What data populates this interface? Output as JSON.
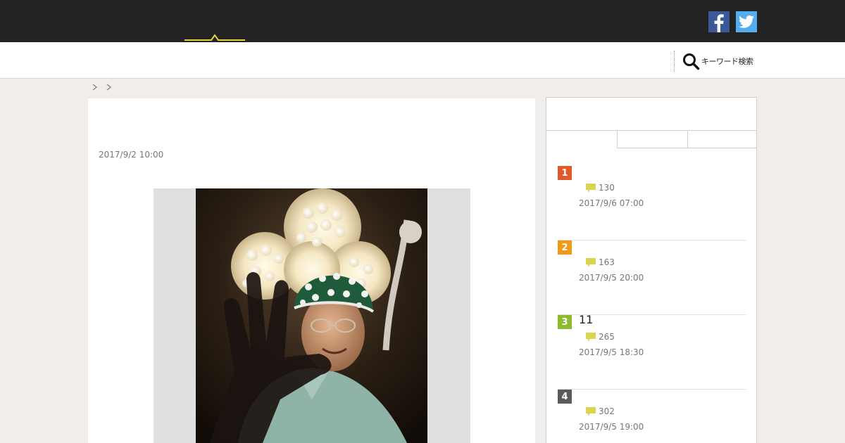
{
  "header": {
    "colors": {
      "bar": "#232323",
      "logo_accent": "#e5d23a",
      "facebook": "#3b5998",
      "twitter": "#55acee"
    },
    "social": [
      {
        "icon": "facebook-icon"
      },
      {
        "icon": "twitter-icon"
      }
    ]
  },
  "search": {
    "label": "キーワード検索",
    "icon": "search-icon"
  },
  "breadcrumb": {
    "separator_icon": "chevron-right-icon"
  },
  "article": {
    "date": "2017/9/2 10:00"
  },
  "sidebar": {
    "ranking": [
      {
        "rank": "1",
        "title": "",
        "comments": "130",
        "date": "2017/9/6 07:00",
        "color": "#e05a2b"
      },
      {
        "rank": "2",
        "title": "",
        "comments": "163",
        "date": "2017/9/5 20:00",
        "color": "#f19a1a"
      },
      {
        "rank": "3",
        "title": "11",
        "comments": "265",
        "date": "2017/9/5 18:30",
        "color": "#8cbc2b"
      },
      {
        "rank": "4",
        "title": "",
        "comments": "302",
        "date": "2017/9/5 19:00",
        "color": "#5a5a5a"
      }
    ],
    "comment_icon_color": "#dcd44e"
  }
}
